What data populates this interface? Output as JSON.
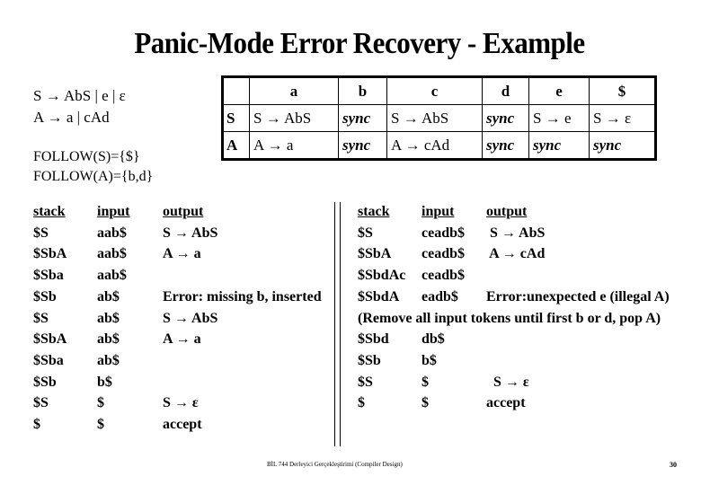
{
  "slide": {
    "title": "Panic-Mode Error Recovery - Example",
    "footer": "BİL 744 Derleyici Gerçekleştirimi (Compiler Design)",
    "page_number": "30"
  },
  "grammar": {
    "rules": [
      "S → AbS  |  e  |  ε",
      "A → a  |  cAd"
    ],
    "follow": [
      "FOLLOW(S)={$}",
      "FOLLOW(A)={b,d}"
    ]
  },
  "parse_table": {
    "columns": [
      "",
      "a",
      "b",
      "c",
      "d",
      "e",
      "$"
    ],
    "rows": [
      {
        "nonterminal": "S",
        "cells": [
          "S → AbS",
          "sync",
          "S → AbS",
          "sync",
          "S → e",
          "S → ε"
        ]
      },
      {
        "nonterminal": "A",
        "cells": [
          "A → a",
          "sync",
          "A → cAd",
          "sync",
          "sync",
          "sync"
        ]
      }
    ]
  },
  "trace_left": {
    "headers": {
      "stack": "stack",
      "input": "input",
      "output": "output"
    },
    "rows": [
      {
        "stack": "$S",
        "input": "aab$",
        "output": "S → AbS"
      },
      {
        "stack": "$SbA",
        "input": "aab$",
        "output": "A → a"
      },
      {
        "stack": "$Sba",
        "input": "aab$",
        "output": ""
      },
      {
        "stack": "$Sb",
        "input": "ab$",
        "output": "Error: missing b, inserted"
      },
      {
        "stack": "$S",
        "input": "ab$",
        "output": "S → AbS"
      },
      {
        "stack": "$SbA",
        "input": "ab$",
        "output": "A → a"
      },
      {
        "stack": "$Sba",
        "input": "ab$",
        "output": ""
      },
      {
        "stack": "$Sb",
        "input": "b$",
        "output": ""
      },
      {
        "stack": "$S",
        "input": "$",
        "output": "S → ε"
      },
      {
        "stack": "$",
        "input": "$",
        "output": "accept"
      }
    ]
  },
  "trace_right": {
    "headers": {
      "stack": "stack",
      "input": "input",
      "output": "output"
    },
    "rows": [
      {
        "stack": "$S",
        "input": "ceadb$",
        "output": " S → AbS"
      },
      {
        "stack": "$SbA",
        "input": "ceadb$",
        "output": " A → cAd"
      },
      {
        "stack": "$SbdAc",
        "input": "ceadb$",
        "output": ""
      },
      {
        "stack": "$SbdA",
        "input": "eadb$",
        "output": "Error:unexpected e (illegal A)"
      },
      {
        "stack": "$Sbd",
        "input": "db$",
        "output": ""
      },
      {
        "stack": "$Sb",
        "input": "b$",
        "output": ""
      },
      {
        "stack": "$S",
        "input": "$",
        "output": "  S → ε"
      },
      {
        "stack": "$",
        "input": "$",
        "output": "accept"
      }
    ],
    "note": "(Remove all input tokens until first b or d, pop A)"
  }
}
